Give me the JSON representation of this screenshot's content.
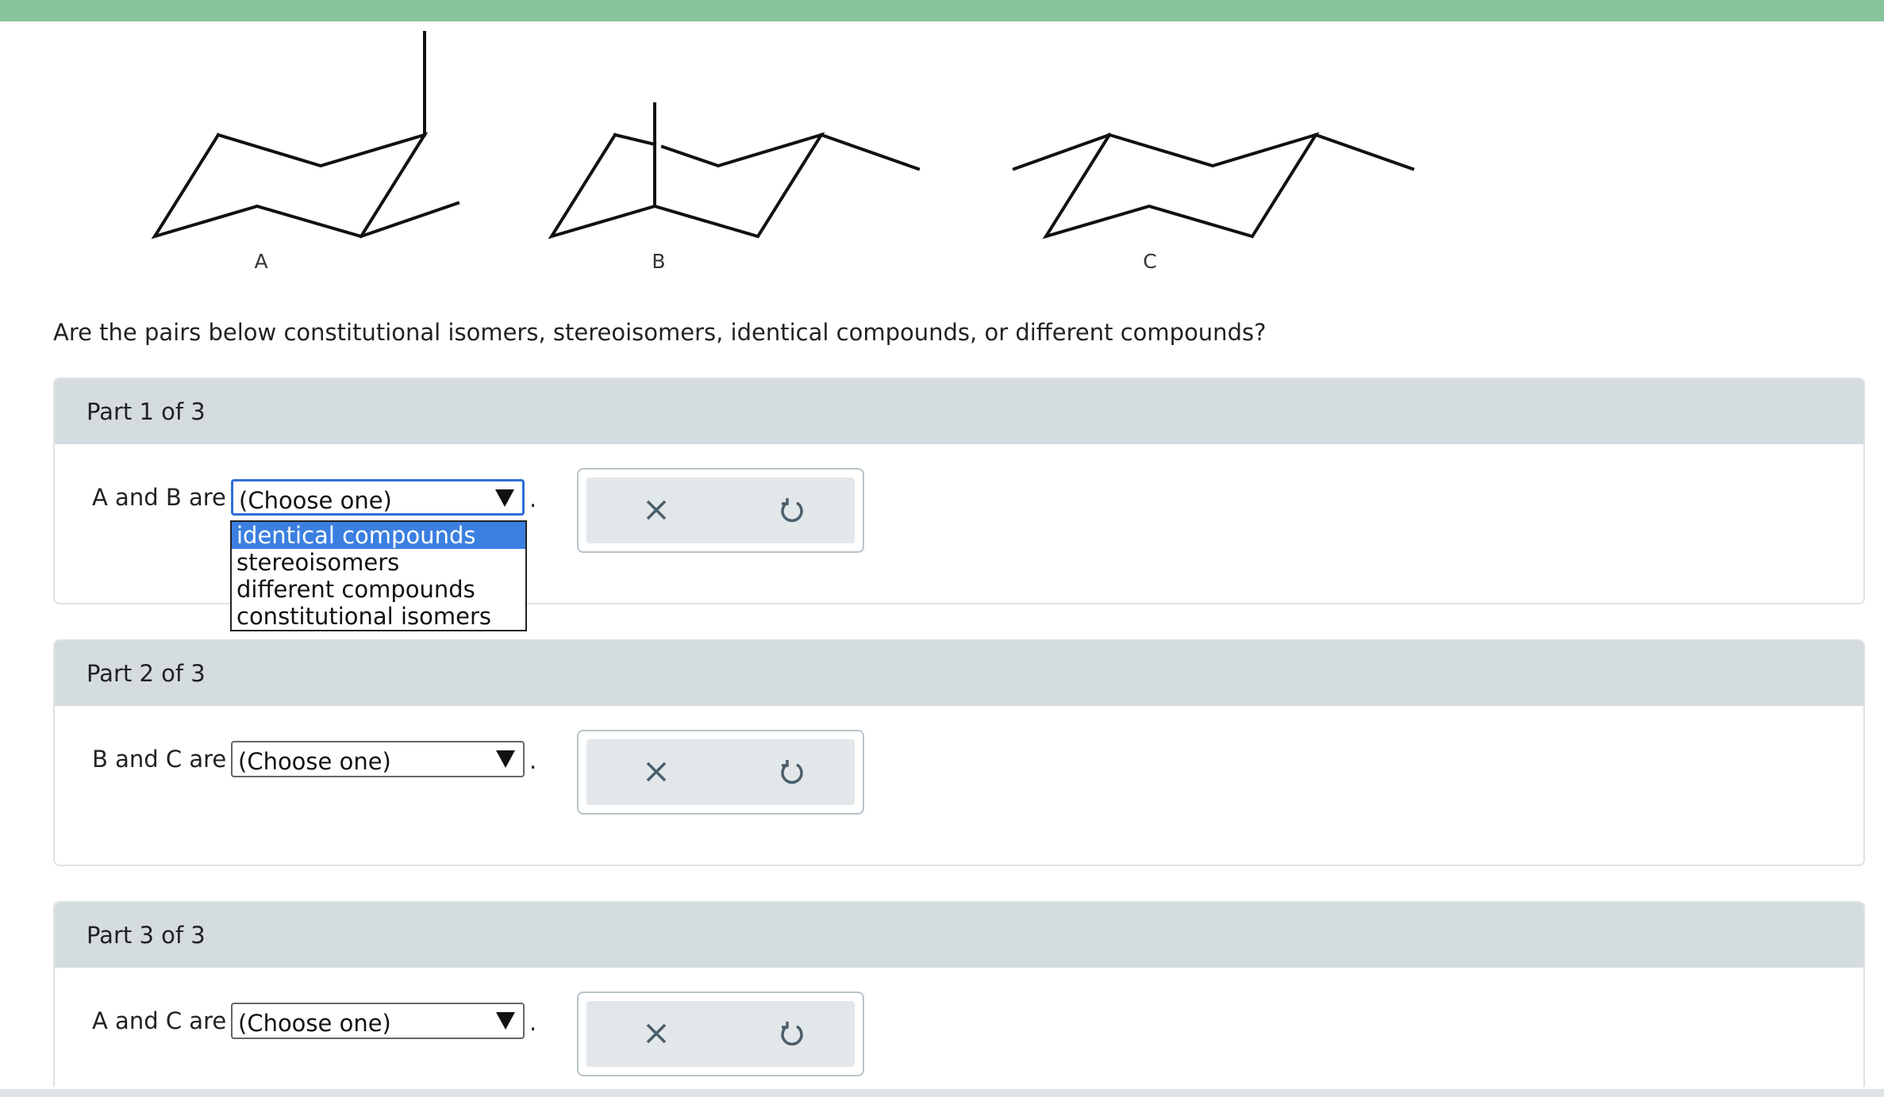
{
  "molecules": [
    {
      "label": "A"
    },
    {
      "label": "B"
    },
    {
      "label": "C"
    }
  ],
  "question": "Are the pairs below constitutional isomers, stereoisomers, identical compounds, or different compounds?",
  "parts": [
    {
      "title": "Part 1 of 3",
      "prompt": "A and B are",
      "selected": "(Choose one)",
      "period": "."
    },
    {
      "title": "Part 2 of 3",
      "prompt": "B and C are",
      "selected": "(Choose one)",
      "period": "."
    },
    {
      "title": "Part 3 of 3",
      "prompt": "A and C are",
      "selected": "(Choose one)",
      "period": "."
    }
  ],
  "dropdown": {
    "options": [
      "identical compounds",
      "stereoisomers",
      "different compounds",
      "constitutional isomers"
    ],
    "highlighted": "identical compounds"
  },
  "icons": {
    "clear": "close-icon",
    "reset": "undo-icon"
  },
  "colors": {
    "top_bar": "#87c49b",
    "part_header": "#d5dcdf",
    "focus_border": "#2f6dd6",
    "highlight": "#3b7fe0",
    "icon": "#4a5e6b"
  }
}
